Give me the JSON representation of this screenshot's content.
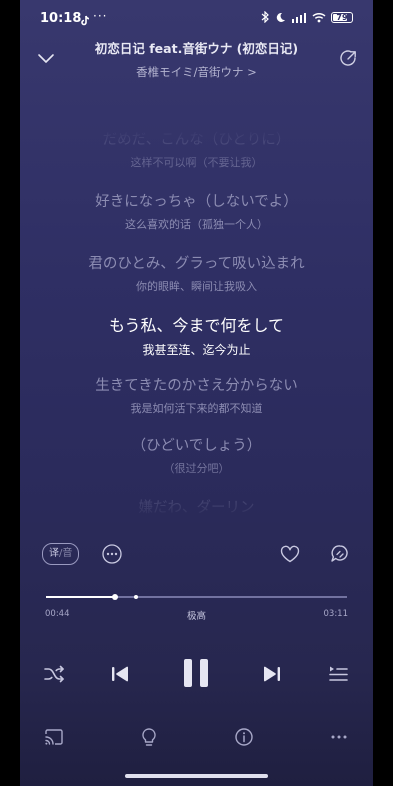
{
  "status_bar": {
    "time": "10:18",
    "app_icon": "tiktok-icon",
    "more": "···",
    "battery": "79",
    "battery_level": 0.79,
    "icons": [
      "bluetooth-icon",
      "moon-icon",
      "signal-icon",
      "wifi-icon",
      "battery-icon"
    ]
  },
  "header": {
    "title": "初恋日记 feat.音街ウナ (初恋日记)",
    "artist": "香椎モイミ/音街ウナ >"
  },
  "lyrics": [
    {
      "jp": "だめだ、こんな（ひとりに）",
      "cn": "这样不可以啊（不要让我）",
      "active": false
    },
    {
      "jp": "好きになっちゃ（しないでよ）",
      "cn": "这么喜欢的话（孤独一个人）",
      "active": false
    },
    {
      "jp": "君のひとみ、グラって吸い込まれ",
      "cn": "你的眼眸、瞬间让我吸入",
      "active": false
    },
    {
      "jp": "もう私、今まで何をして",
      "cn": "我甚至连、迄今为止",
      "active": true
    },
    {
      "jp": "生きてきたのかさえ分からない",
      "cn": "我是如何活下来的都不知道",
      "active": false
    },
    {
      "jp": "（ひどいでしょう）",
      "cn": "（很过分吧）",
      "active": false
    },
    {
      "jp": "嫌だわ、ダーリン",
      "cn": "",
      "active": false
    }
  ],
  "actions": {
    "translate_on": "译",
    "translate_sep": "/",
    "translate_off": "音"
  },
  "playback": {
    "current_time": "00:44",
    "total_time": "03:11",
    "quality": "极高",
    "progress": 0.23,
    "buffered_marker": 0.3
  },
  "colors": {
    "accent": "#ffffff",
    "background_top": "#38386e",
    "background_bottom": "#1f1f40",
    "inactive_lyric": "#8c8cb2"
  },
  "icons": {
    "collapse": "chevron-down-icon",
    "share": "share-icon",
    "more": "more-icon",
    "like": "heart-icon",
    "comment": "comment-icon",
    "shuffle": "shuffle-icon",
    "prev": "previous-icon",
    "pause": "pause-icon",
    "next": "next-icon",
    "playlist": "playlist-icon",
    "cast": "cast-icon",
    "idea": "lightbulb-icon",
    "info": "info-icon",
    "bottom_more": "more-horizontal-icon"
  }
}
